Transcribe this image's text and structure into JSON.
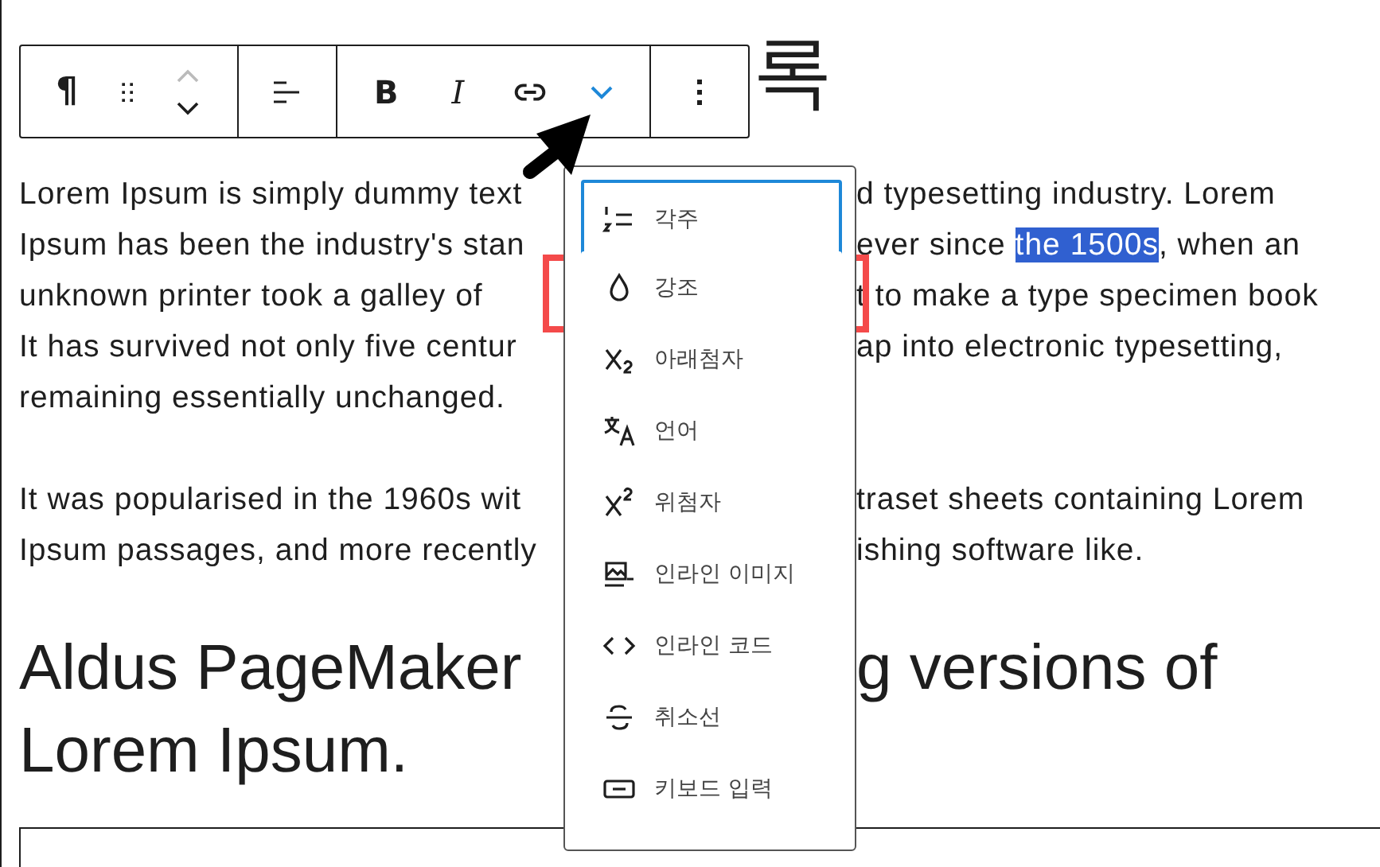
{
  "title_fragment": "록",
  "toolbar": {
    "block_type": "¶",
    "move_up_disabled": true,
    "bold": "B",
    "italic": "I",
    "more_expanded": true
  },
  "paragraphs": [
    {
      "lines": [
        {
          "left": "Lorem Ipsum is simply dummy text",
          "right": [
            {
              "text": "d typesetting industry. Lorem",
              "selected": false
            }
          ]
        },
        {
          "left": "Ipsum has been the industry's stan",
          "right": [
            {
              "text": "ever since ",
              "selected": false
            },
            {
              "text": "the 1500s",
              "selected": true
            },
            {
              "text": ", when an",
              "selected": false
            }
          ]
        },
        {
          "left": "unknown printer took a galley of",
          "right": [
            {
              "text": "t to make a type specimen book",
              "selected": false
            }
          ]
        },
        {
          "left": "It has survived not only five centur",
          "right": [
            {
              "text": "ap into electronic typesetting,",
              "selected": false
            }
          ]
        },
        {
          "left": "remaining essentially unchanged."
        }
      ]
    },
    {
      "lines": [
        {
          "left": "It was popularised in the 1960s wit",
          "right": [
            {
              "text": "traset sheets containing Lorem",
              "selected": false
            }
          ]
        },
        {
          "left": "Ipsum passages, and more recently",
          "right": [
            {
              "text": "ishing software like.",
              "selected": false
            }
          ]
        }
      ]
    }
  ],
  "heading": {
    "lines": [
      {
        "left": "Aldus PageMaker",
        "right": [
          {
            "text": "g versions of",
            "selected": false
          }
        ]
      },
      {
        "left": "Lorem Ipsum."
      }
    ]
  },
  "menu": {
    "items": [
      {
        "label": "각주",
        "focused": true,
        "marked": false
      },
      {
        "label": "강조",
        "focused": false,
        "marked": true
      },
      {
        "label": "아래첨자",
        "focused": false,
        "marked": false
      },
      {
        "label": "언어",
        "focused": false,
        "marked": false
      },
      {
        "label": "위첨자",
        "focused": false,
        "marked": false
      },
      {
        "label": "인라인 이미지",
        "focused": false,
        "marked": false
      },
      {
        "label": "인라인 코드",
        "focused": false,
        "marked": false
      },
      {
        "label": "취소선",
        "focused": false,
        "marked": false
      },
      {
        "label": "키보드 입력",
        "focused": false,
        "marked": false
      }
    ]
  }
}
